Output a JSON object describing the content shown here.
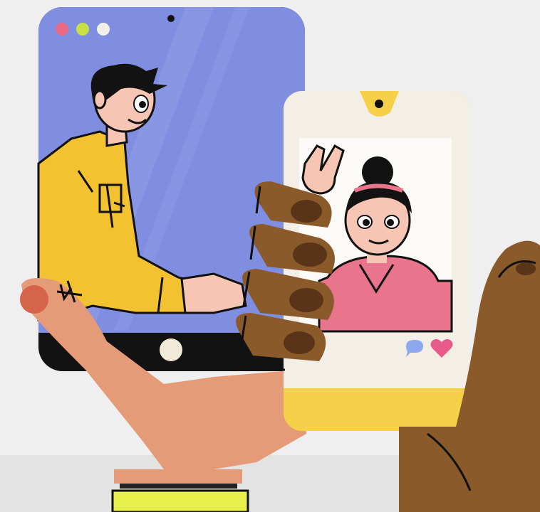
{
  "scene": {
    "subject": "two-hands-holding-phones-video-chat",
    "colors": {
      "background": "#efefef",
      "left_phone_screen": "#7f8ee0",
      "left_phone_frame": "#121212",
      "right_phone_body": "#f7d049",
      "right_phone_screen": "#f4efe6",
      "light_hand": "#e59a78",
      "dark_hand": "#8b5a2b",
      "jacket": "#f2c230",
      "woman_shirt": "#e9758d",
      "heart": "#e85a8a",
      "chat_bubble": "#8fa7ee"
    },
    "icons": [
      "window-dot-red",
      "window-dot-green",
      "window-dot-white",
      "camera-notch",
      "chat-bubble-icon",
      "heart-icon"
    ]
  }
}
